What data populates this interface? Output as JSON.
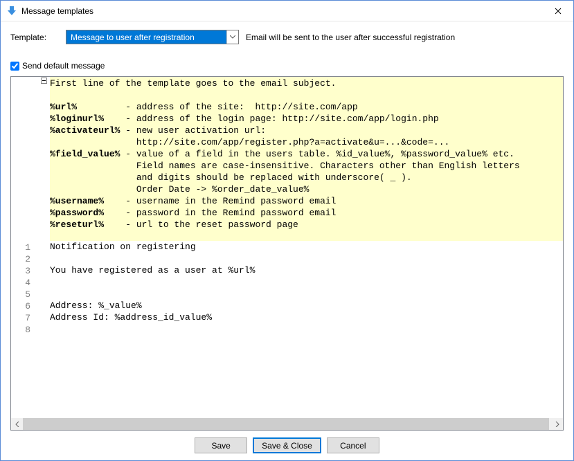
{
  "window": {
    "title": "Message templates"
  },
  "template_label": "Template:",
  "template_select": {
    "value": "Message to user after registration",
    "description": "Email will be sent to the user after successful registration"
  },
  "checkbox": {
    "label": "Send default message",
    "checked": true
  },
  "hint": {
    "lines": [
      {
        "prefix": "",
        "tok": "",
        "text": "First line of the template goes to the email subject."
      },
      {
        "prefix": "",
        "tok": "",
        "text": ""
      },
      {
        "prefix": "",
        "tok": "%url%",
        "text": "         - address of the site:  http://site.com/app"
      },
      {
        "prefix": "",
        "tok": "%loginurl%",
        "text": "    - address of the login page: http://site.com/app/login.php"
      },
      {
        "prefix": "",
        "tok": "%activateurl%",
        "text": " - new user activation url:"
      },
      {
        "prefix": "                ",
        "tok": "",
        "text": "http://site.com/app/register.php?a=activate&u=...&code=..."
      },
      {
        "prefix": "",
        "tok": "%field_value%",
        "text": " - value of a field in the users table. %id_value%, %password_value% etc."
      },
      {
        "prefix": "                ",
        "tok": "",
        "text": "Field names are case-insensitive. Characters other than English letters"
      },
      {
        "prefix": "                ",
        "tok": "",
        "text": "and digits should be replaced with underscore( _ )."
      },
      {
        "prefix": "                ",
        "tok": "",
        "text": "Order Date -> %order_date_value%"
      },
      {
        "prefix": "",
        "tok": "%username%",
        "text": "    - username in the Remind password email"
      },
      {
        "prefix": "",
        "tok": "%password%",
        "text": "    - password in the Remind password email"
      },
      {
        "prefix": "",
        "tok": "%reseturl%",
        "text": "    - url to the reset password page"
      },
      {
        "prefix": "",
        "tok": "",
        "text": ""
      }
    ]
  },
  "code": {
    "lines": [
      "Notification on registering",
      "",
      "You have registered as a user at %url%",
      "",
      "",
      "Address: %_value%",
      "Address Id: %address_id_value%",
      ""
    ]
  },
  "buttons": {
    "save": "Save",
    "save_close": "Save & Close",
    "cancel": "Cancel"
  }
}
